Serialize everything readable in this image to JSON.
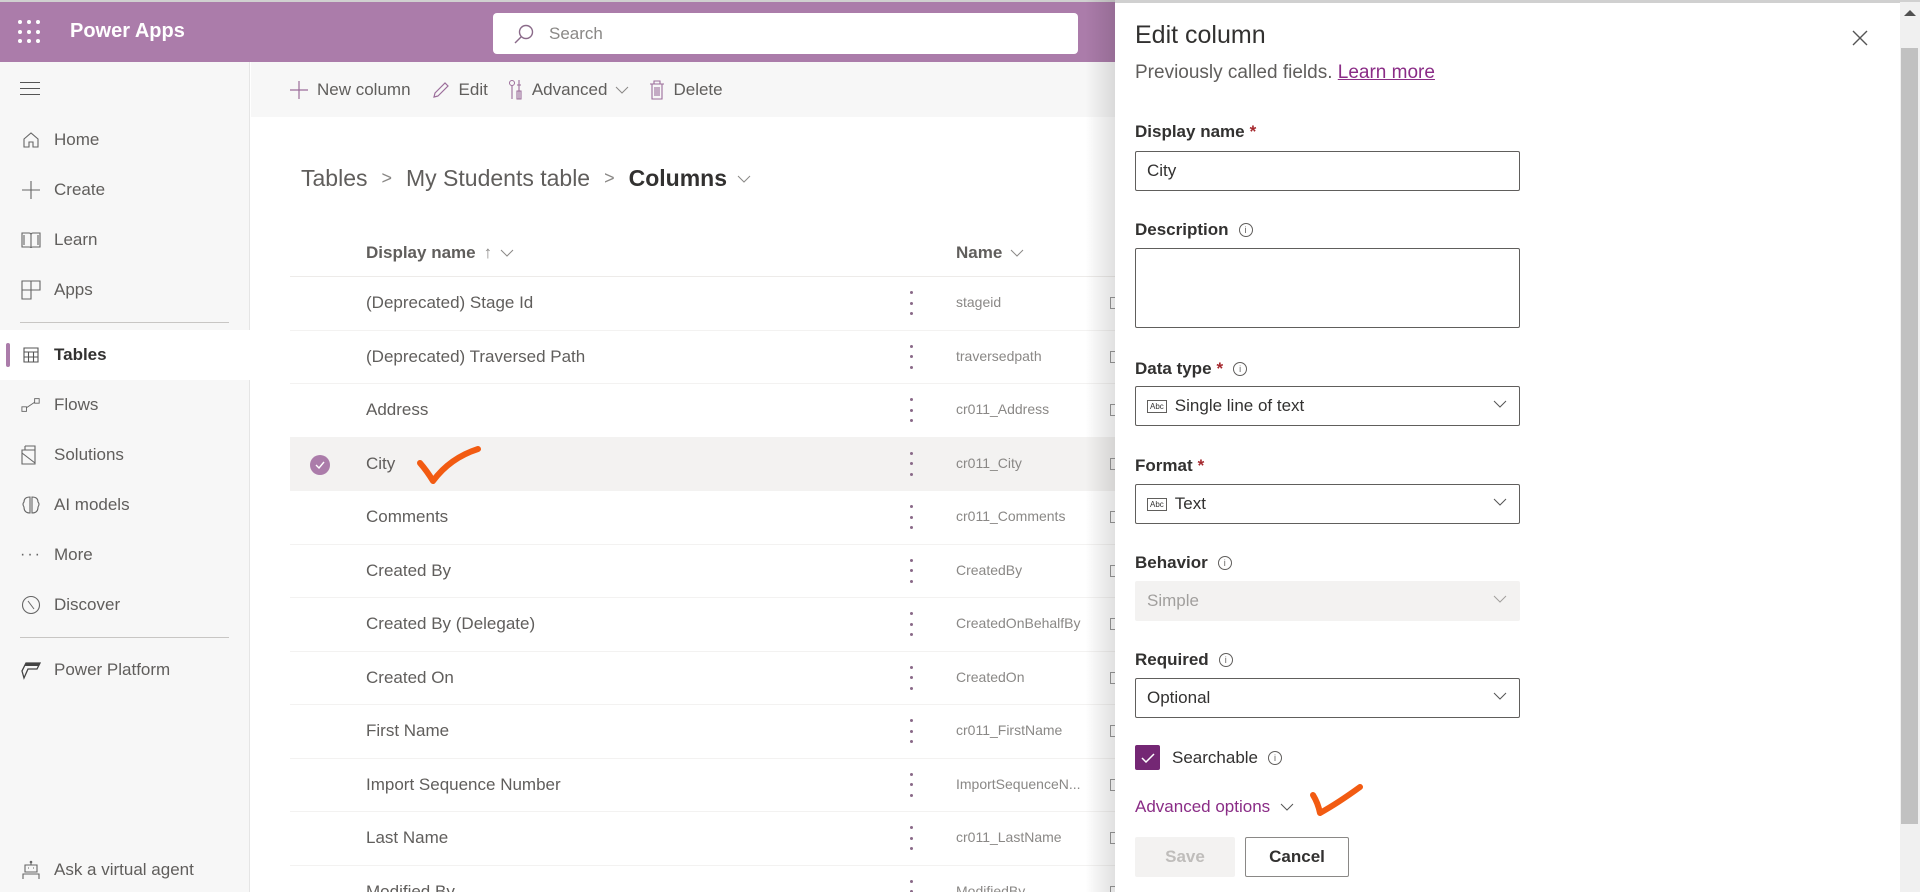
{
  "header": {
    "app_title": "Power Apps",
    "search_placeholder": "Search",
    "brand_color": "#ab7caa"
  },
  "sidebar": {
    "items": [
      {
        "label": "Home",
        "icon": "home-icon"
      },
      {
        "label": "Create",
        "icon": "plus-icon"
      },
      {
        "label": "Learn",
        "icon": "book-icon"
      },
      {
        "label": "Apps",
        "icon": "apps-icon"
      },
      {
        "label": "Tables",
        "icon": "table-icon",
        "active": true
      },
      {
        "label": "Flows",
        "icon": "flow-icon"
      },
      {
        "label": "Solutions",
        "icon": "solutions-icon"
      },
      {
        "label": "AI models",
        "icon": "brain-icon"
      },
      {
        "label": "More",
        "icon": "ellipsis-icon"
      },
      {
        "label": "Discover",
        "icon": "compass-icon"
      },
      {
        "label": "Power Platform",
        "icon": "power-platform-icon"
      }
    ],
    "footer_label": "Ask a virtual agent"
  },
  "toolbar": {
    "new_column": "New column",
    "edit": "Edit",
    "advanced": "Advanced",
    "delete": "Delete"
  },
  "breadcrumb": {
    "items": [
      "Tables",
      "My Students table"
    ],
    "current": "Columns"
  },
  "table": {
    "columns": [
      "Display name",
      "Name"
    ],
    "sort_indicator": "↑",
    "rows": [
      {
        "display_name": "(Deprecated) Stage Id",
        "name": "stageid"
      },
      {
        "display_name": "(Deprecated) Traversed Path",
        "name": "traversedpath"
      },
      {
        "display_name": "Address",
        "name": "cr011_Address"
      },
      {
        "display_name": "City",
        "name": "cr011_City",
        "selected": true
      },
      {
        "display_name": "Comments",
        "name": "cr011_Comments"
      },
      {
        "display_name": "Created By",
        "name": "CreatedBy"
      },
      {
        "display_name": "Created By (Delegate)",
        "name": "CreatedOnBehalfBy"
      },
      {
        "display_name": "Created On",
        "name": "CreatedOn"
      },
      {
        "display_name": "First Name",
        "name": "cr011_FirstName"
      },
      {
        "display_name": "Import Sequence Number",
        "name": "ImportSequenceN..."
      },
      {
        "display_name": "Last Name",
        "name": "cr011_LastName"
      },
      {
        "display_name": "Modified By",
        "name": "ModifiedBy"
      }
    ]
  },
  "panel": {
    "title": "Edit column",
    "subtitle": "Previously called fields.",
    "learn_more": "Learn more",
    "display_name_label": "Display name",
    "display_name_value": "City",
    "description_label": "Description",
    "description_value": "",
    "data_type_label": "Data type",
    "data_type_value": "Single line of text",
    "format_label": "Format",
    "format_value": "Text",
    "behavior_label": "Behavior",
    "behavior_value": "Simple",
    "required_label": "Required",
    "required_value": "Optional",
    "searchable_label": "Searchable",
    "searchable_checked": true,
    "advanced_options": "Advanced options",
    "save": "Save",
    "cancel": "Cancel",
    "required_mark": "*",
    "info_glyph": "i",
    "abc_glyph": "Abc"
  }
}
